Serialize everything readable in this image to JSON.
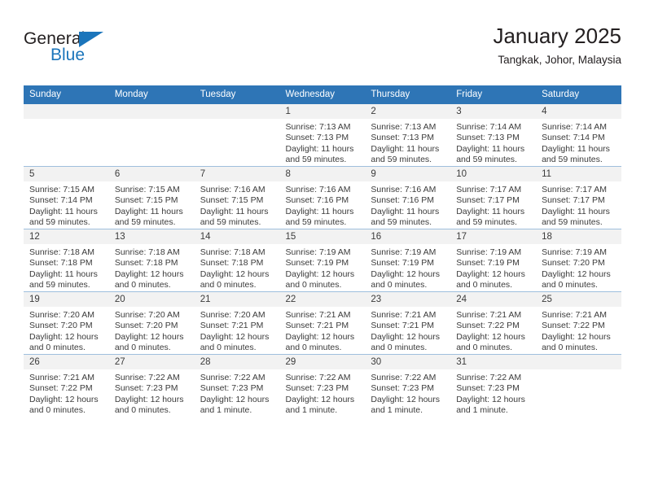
{
  "brand": {
    "name_part1": "General",
    "name_part2": "Blue",
    "flag_icon": "triangle-flag-icon"
  },
  "header": {
    "title": "January 2025",
    "subtitle": "Tangkak, Johor, Malaysia"
  },
  "colors": {
    "header_blue": "#2e75b6",
    "brand_blue": "#1b75bb",
    "daynum_band": "#f2f2f2",
    "text": "#3b3b3b"
  },
  "weekdays": [
    "Sunday",
    "Monday",
    "Tuesday",
    "Wednesday",
    "Thursday",
    "Friday",
    "Saturday"
  ],
  "weeks": [
    [
      {
        "day": "",
        "sunrise": "",
        "sunset": "",
        "daylight_1": "",
        "daylight_2": ""
      },
      {
        "day": "",
        "sunrise": "",
        "sunset": "",
        "daylight_1": "",
        "daylight_2": ""
      },
      {
        "day": "",
        "sunrise": "",
        "sunset": "",
        "daylight_1": "",
        "daylight_2": ""
      },
      {
        "day": "1",
        "sunrise": "Sunrise: 7:13 AM",
        "sunset": "Sunset: 7:13 PM",
        "daylight_1": "Daylight: 11 hours",
        "daylight_2": "and 59 minutes."
      },
      {
        "day": "2",
        "sunrise": "Sunrise: 7:13 AM",
        "sunset": "Sunset: 7:13 PM",
        "daylight_1": "Daylight: 11 hours",
        "daylight_2": "and 59 minutes."
      },
      {
        "day": "3",
        "sunrise": "Sunrise: 7:14 AM",
        "sunset": "Sunset: 7:13 PM",
        "daylight_1": "Daylight: 11 hours",
        "daylight_2": "and 59 minutes."
      },
      {
        "day": "4",
        "sunrise": "Sunrise: 7:14 AM",
        "sunset": "Sunset: 7:14 PM",
        "daylight_1": "Daylight: 11 hours",
        "daylight_2": "and 59 minutes."
      }
    ],
    [
      {
        "day": "5",
        "sunrise": "Sunrise: 7:15 AM",
        "sunset": "Sunset: 7:14 PM",
        "daylight_1": "Daylight: 11 hours",
        "daylight_2": "and 59 minutes."
      },
      {
        "day": "6",
        "sunrise": "Sunrise: 7:15 AM",
        "sunset": "Sunset: 7:15 PM",
        "daylight_1": "Daylight: 11 hours",
        "daylight_2": "and 59 minutes."
      },
      {
        "day": "7",
        "sunrise": "Sunrise: 7:16 AM",
        "sunset": "Sunset: 7:15 PM",
        "daylight_1": "Daylight: 11 hours",
        "daylight_2": "and 59 minutes."
      },
      {
        "day": "8",
        "sunrise": "Sunrise: 7:16 AM",
        "sunset": "Sunset: 7:16 PM",
        "daylight_1": "Daylight: 11 hours",
        "daylight_2": "and 59 minutes."
      },
      {
        "day": "9",
        "sunrise": "Sunrise: 7:16 AM",
        "sunset": "Sunset: 7:16 PM",
        "daylight_1": "Daylight: 11 hours",
        "daylight_2": "and 59 minutes."
      },
      {
        "day": "10",
        "sunrise": "Sunrise: 7:17 AM",
        "sunset": "Sunset: 7:17 PM",
        "daylight_1": "Daylight: 11 hours",
        "daylight_2": "and 59 minutes."
      },
      {
        "day": "11",
        "sunrise": "Sunrise: 7:17 AM",
        "sunset": "Sunset: 7:17 PM",
        "daylight_1": "Daylight: 11 hours",
        "daylight_2": "and 59 minutes."
      }
    ],
    [
      {
        "day": "12",
        "sunrise": "Sunrise: 7:18 AM",
        "sunset": "Sunset: 7:18 PM",
        "daylight_1": "Daylight: 11 hours",
        "daylight_2": "and 59 minutes."
      },
      {
        "day": "13",
        "sunrise": "Sunrise: 7:18 AM",
        "sunset": "Sunset: 7:18 PM",
        "daylight_1": "Daylight: 12 hours",
        "daylight_2": "and 0 minutes."
      },
      {
        "day": "14",
        "sunrise": "Sunrise: 7:18 AM",
        "sunset": "Sunset: 7:18 PM",
        "daylight_1": "Daylight: 12 hours",
        "daylight_2": "and 0 minutes."
      },
      {
        "day": "15",
        "sunrise": "Sunrise: 7:19 AM",
        "sunset": "Sunset: 7:19 PM",
        "daylight_1": "Daylight: 12 hours",
        "daylight_2": "and 0 minutes."
      },
      {
        "day": "16",
        "sunrise": "Sunrise: 7:19 AM",
        "sunset": "Sunset: 7:19 PM",
        "daylight_1": "Daylight: 12 hours",
        "daylight_2": "and 0 minutes."
      },
      {
        "day": "17",
        "sunrise": "Sunrise: 7:19 AM",
        "sunset": "Sunset: 7:19 PM",
        "daylight_1": "Daylight: 12 hours",
        "daylight_2": "and 0 minutes."
      },
      {
        "day": "18",
        "sunrise": "Sunrise: 7:19 AM",
        "sunset": "Sunset: 7:20 PM",
        "daylight_1": "Daylight: 12 hours",
        "daylight_2": "and 0 minutes."
      }
    ],
    [
      {
        "day": "19",
        "sunrise": "Sunrise: 7:20 AM",
        "sunset": "Sunset: 7:20 PM",
        "daylight_1": "Daylight: 12 hours",
        "daylight_2": "and 0 minutes."
      },
      {
        "day": "20",
        "sunrise": "Sunrise: 7:20 AM",
        "sunset": "Sunset: 7:20 PM",
        "daylight_1": "Daylight: 12 hours",
        "daylight_2": "and 0 minutes."
      },
      {
        "day": "21",
        "sunrise": "Sunrise: 7:20 AM",
        "sunset": "Sunset: 7:21 PM",
        "daylight_1": "Daylight: 12 hours",
        "daylight_2": "and 0 minutes."
      },
      {
        "day": "22",
        "sunrise": "Sunrise: 7:21 AM",
        "sunset": "Sunset: 7:21 PM",
        "daylight_1": "Daylight: 12 hours",
        "daylight_2": "and 0 minutes."
      },
      {
        "day": "23",
        "sunrise": "Sunrise: 7:21 AM",
        "sunset": "Sunset: 7:21 PM",
        "daylight_1": "Daylight: 12 hours",
        "daylight_2": "and 0 minutes."
      },
      {
        "day": "24",
        "sunrise": "Sunrise: 7:21 AM",
        "sunset": "Sunset: 7:22 PM",
        "daylight_1": "Daylight: 12 hours",
        "daylight_2": "and 0 minutes."
      },
      {
        "day": "25",
        "sunrise": "Sunrise: 7:21 AM",
        "sunset": "Sunset: 7:22 PM",
        "daylight_1": "Daylight: 12 hours",
        "daylight_2": "and 0 minutes."
      }
    ],
    [
      {
        "day": "26",
        "sunrise": "Sunrise: 7:21 AM",
        "sunset": "Sunset: 7:22 PM",
        "daylight_1": "Daylight: 12 hours",
        "daylight_2": "and 0 minutes."
      },
      {
        "day": "27",
        "sunrise": "Sunrise: 7:22 AM",
        "sunset": "Sunset: 7:23 PM",
        "daylight_1": "Daylight: 12 hours",
        "daylight_2": "and 0 minutes."
      },
      {
        "day": "28",
        "sunrise": "Sunrise: 7:22 AM",
        "sunset": "Sunset: 7:23 PM",
        "daylight_1": "Daylight: 12 hours",
        "daylight_2": "and 1 minute."
      },
      {
        "day": "29",
        "sunrise": "Sunrise: 7:22 AM",
        "sunset": "Sunset: 7:23 PM",
        "daylight_1": "Daylight: 12 hours",
        "daylight_2": "and 1 minute."
      },
      {
        "day": "30",
        "sunrise": "Sunrise: 7:22 AM",
        "sunset": "Sunset: 7:23 PM",
        "daylight_1": "Daylight: 12 hours",
        "daylight_2": "and 1 minute."
      },
      {
        "day": "31",
        "sunrise": "Sunrise: 7:22 AM",
        "sunset": "Sunset: 7:23 PM",
        "daylight_1": "Daylight: 12 hours",
        "daylight_2": "and 1 minute."
      },
      {
        "day": "",
        "sunrise": "",
        "sunset": "",
        "daylight_1": "",
        "daylight_2": ""
      }
    ]
  ]
}
